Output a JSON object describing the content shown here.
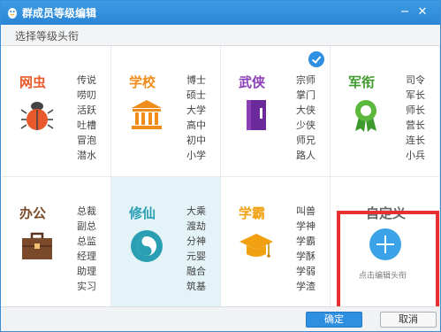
{
  "window": {
    "title": "群成员等级编辑"
  },
  "subheader": {
    "label": "选择等级头衔"
  },
  "categories": [
    {
      "name": "网虫",
      "color": "#e8592b",
      "icon": "bug-icon",
      "ranks": [
        "传说",
        "唠叨",
        "活跃",
        "吐槽",
        "冒泡",
        "潜水"
      ]
    },
    {
      "name": "学校",
      "color": "#f08c1a",
      "icon": "school-icon",
      "ranks": [
        "博士",
        "硕士",
        "大学",
        "高中",
        "初中",
        "小学"
      ]
    },
    {
      "name": "武侠",
      "color": "#8a3fb6",
      "icon": "book-icon",
      "ranks": [
        "宗师",
        "掌门",
        "大侠",
        "少侠",
        "师兄",
        "路人"
      ],
      "checked": true
    },
    {
      "name": "军衔",
      "color": "#3f9a2d",
      "icon": "medal-icon",
      "ranks": [
        "司令",
        "军长",
        "师长",
        "营长",
        "连长",
        "小兵"
      ]
    },
    {
      "name": "办公",
      "color": "#7b4a2a",
      "icon": "briefcase-icon",
      "ranks": [
        "总裁",
        "副总",
        "总监",
        "经理",
        "助理",
        "实习"
      ]
    },
    {
      "name": "修仙",
      "color": "#2a9fb4",
      "icon": "yinyang-icon",
      "ranks": [
        "大乘",
        "渡劫",
        "分神",
        "元婴",
        "融合",
        "筑基"
      ],
      "selected": true
    },
    {
      "name": "学霸",
      "color": "#f0a010",
      "icon": "graduation-cap-icon",
      "ranks": [
        "叫兽",
        "学神",
        "学霸",
        "学酥",
        "学弱",
        "学渣"
      ]
    }
  ],
  "custom": {
    "title": "自定义",
    "hint": "点击编辑头衔",
    "icon": "plus-icon"
  },
  "footer": {
    "ok_label": "确定",
    "cancel_label": "取消"
  },
  "colors": {
    "titlebar": "#2a86d6",
    "accent": "#2f8fe0",
    "highlight_border": "#e8302f",
    "selected_bg": "#e3f3f7"
  }
}
